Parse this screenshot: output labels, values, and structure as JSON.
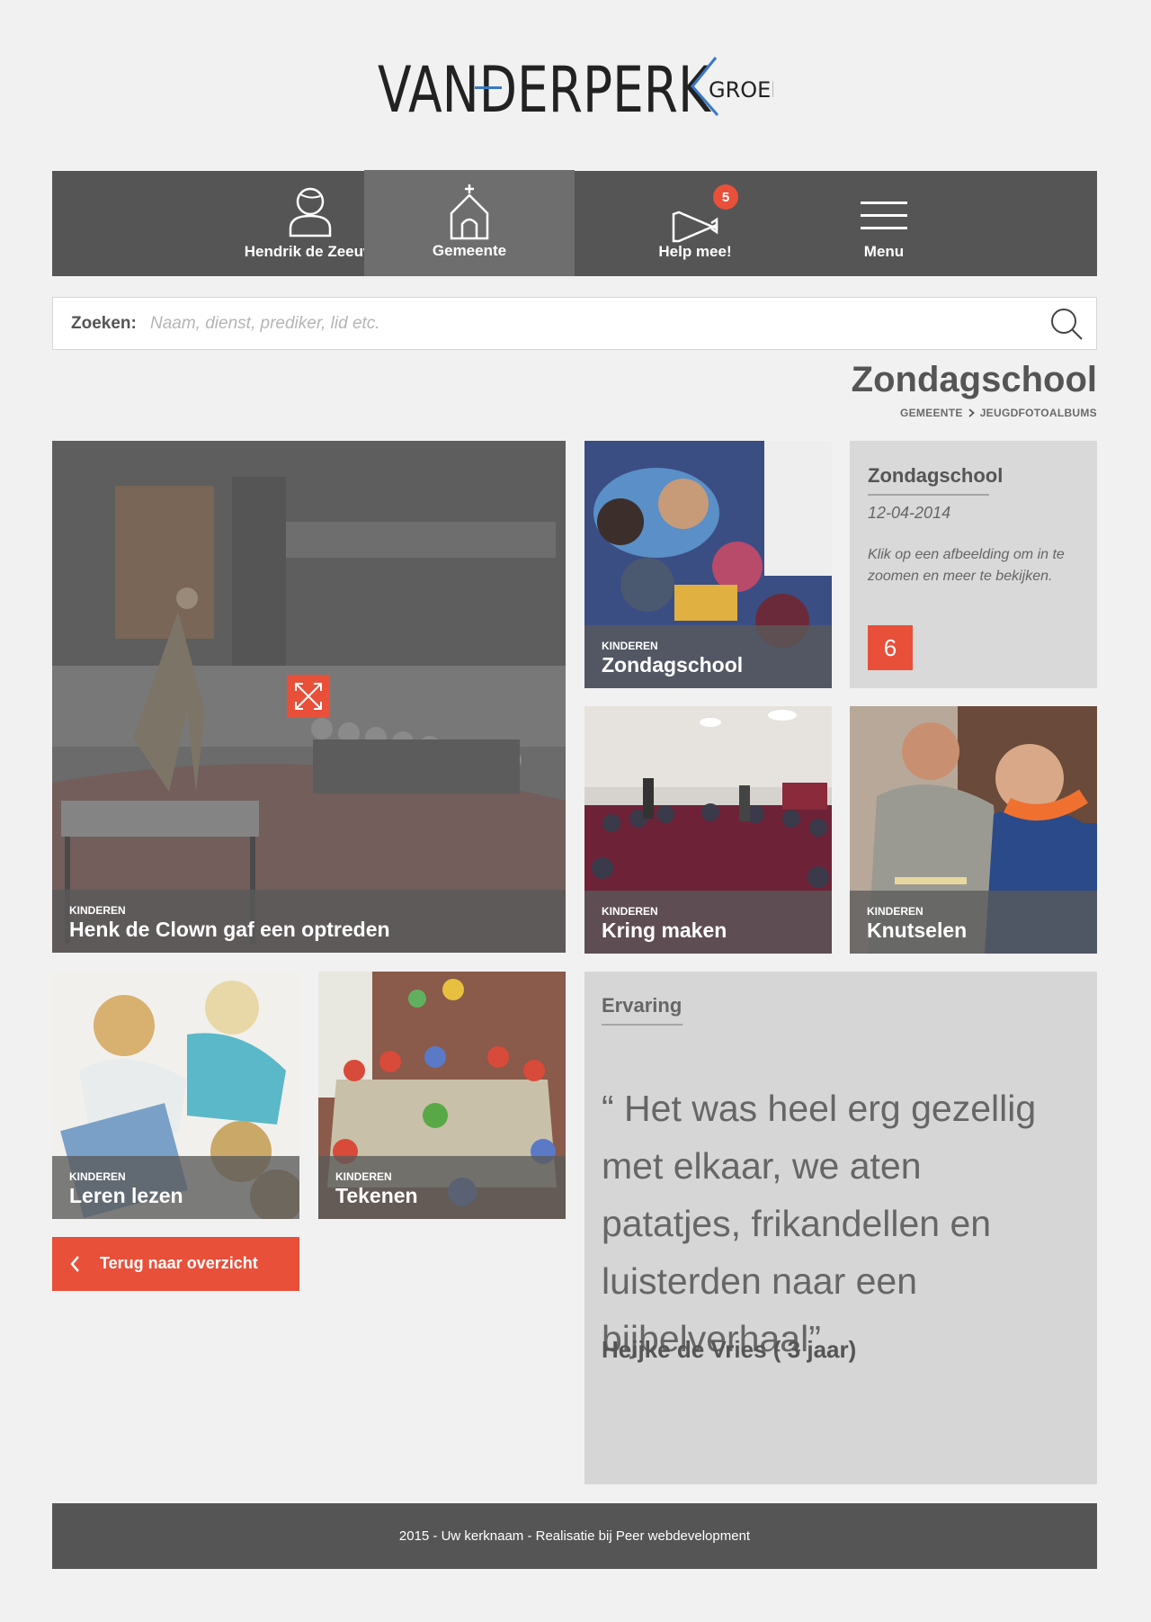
{
  "brand": {
    "logo_main": "VANDERPERK",
    "logo_sub": "GROEP",
    "accent": "#e8503a",
    "logo_blue": "#3a78c8"
  },
  "nav": {
    "items": [
      {
        "label": "Hendrik de Zeeuw",
        "icon": "user-icon"
      },
      {
        "label": "Gemeente",
        "icon": "church-icon",
        "active": true
      },
      {
        "label": "Help mee!",
        "icon": "megaphone-icon",
        "badge": "5"
      },
      {
        "label": "Menu",
        "icon": "hamburger-icon"
      }
    ]
  },
  "search": {
    "label": "Zoeken:",
    "placeholder": "Naam, dienst, prediker, lid etc."
  },
  "page": {
    "title": "Zondagschool",
    "breadcrumb": [
      "GEMEENTE",
      "JEUGDFOTOALBUMS"
    ]
  },
  "tiles": [
    {
      "category": "KINDEREN",
      "title": "Henk de Clown gaf een optreden"
    },
    {
      "category": "KINDEREN",
      "title": "Zondagschool"
    },
    {
      "category": "KINDEREN",
      "title": "Kring maken"
    },
    {
      "category": "KINDEREN",
      "title": "Knutselen"
    },
    {
      "category": "KINDEREN",
      "title": "Leren lezen"
    },
    {
      "category": "KINDEREN",
      "title": "Tekenen"
    }
  ],
  "info": {
    "title": "Zondagschool",
    "date": "12-04-2014",
    "text": "Klik op een afbeelding om in te zoomen en meer te bekijken.",
    "count": "6"
  },
  "quote": {
    "heading": "Ervaring",
    "text": "“ Het was heel erg gezellig met elkaar, we aten patatjes, frikandellen en luisterden naar een bijbelverhaal”",
    "author": "Heijke de Vries ( 3 jaar)"
  },
  "back_button": {
    "label": "Terug naar overzicht"
  },
  "footer": {
    "text": "2015 - Uw kerknaam - Realisatie bij Peer webdevelopment"
  }
}
